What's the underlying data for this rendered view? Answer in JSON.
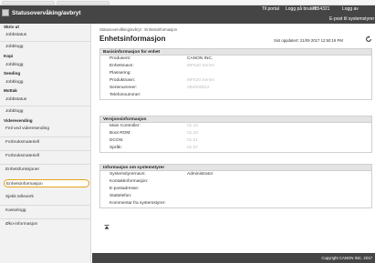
{
  "header": {
    "app_title": "Statusovervåking/avbryt",
    "top_page": "Til portal",
    "logout": "Logg på bruker:",
    "user_label": "7654321",
    "user_value": "Logg av",
    "esys": "E-post til systemstyrer"
  },
  "sidebar": {
    "heads": [
      "Skriv ut",
      "Kopi",
      "Sending",
      "Mottak",
      "Videresending"
    ],
    "items": [
      "Jobbstatus",
      "Jobblogg",
      "Jobblogg",
      "Jobblogg",
      "Jobbstatus",
      "Jobblogg",
      "Feil ved videresending",
      "Forbruksmateriell",
      "Forbruksmateriell",
      "Enhetsfunksjoner",
      "Enhetsinformasjon",
      "Sjekk telleverk",
      "Kasselogg",
      "Øko-informasjon"
    ]
  },
  "main": {
    "breadcrumb": "Statusovervåking/avbryt : Enhetsinformasjon",
    "title": "Enhetsinformasjon",
    "updated": "Sist oppdatert: 21/09 2017 12:50:19 PM"
  },
  "sections": [
    {
      "title": "Basisinformasjon for enhet",
      "rows": [
        {
          "label": "Produsent:",
          "value": "CANON INC."
        },
        {
          "label": "Enhetsnavn:",
          "value": "MF520 Series"
        },
        {
          "label": "Plassering:",
          "value": ""
        },
        {
          "label": "Produktnavn:",
          "value": "MF520 Series"
        },
        {
          "label": "Serienummer:",
          "value": "2B4000012"
        },
        {
          "label": "Telefonnummer:",
          "value": ""
        }
      ]
    },
    {
      "title": "Versjonsinformasjon",
      "rows": [
        {
          "label": "Main Controller:",
          "value": "01.10"
        },
        {
          "label": "Boot ROM:",
          "value": "01.20"
        },
        {
          "label": "DCON:",
          "value": "01.01"
        },
        {
          "label": "Språk:",
          "value": "01.07"
        }
      ]
    },
    {
      "title": "Informasjon om systemstyrer",
      "rows": [
        {
          "label": "Systemstyrernavn:",
          "value": "Administrator"
        },
        {
          "label": "Kontaktinformasjon:",
          "value": ""
        },
        {
          "label": "E-postadresse:",
          "value": ""
        },
        {
          "label": "Stattelefon:",
          "value": ""
        },
        {
          "label": "Kommentar fra systemstyrer:",
          "value": ""
        }
      ]
    }
  ],
  "footer": {
    "copyright": "Copyright CANON INC. 2017"
  },
  "colors": {
    "topbar": "#454545",
    "selected_outline": "#e8a21a"
  },
  "icons": [
    "refresh-icon",
    "scroll-top-icon",
    "logo-icon"
  ]
}
